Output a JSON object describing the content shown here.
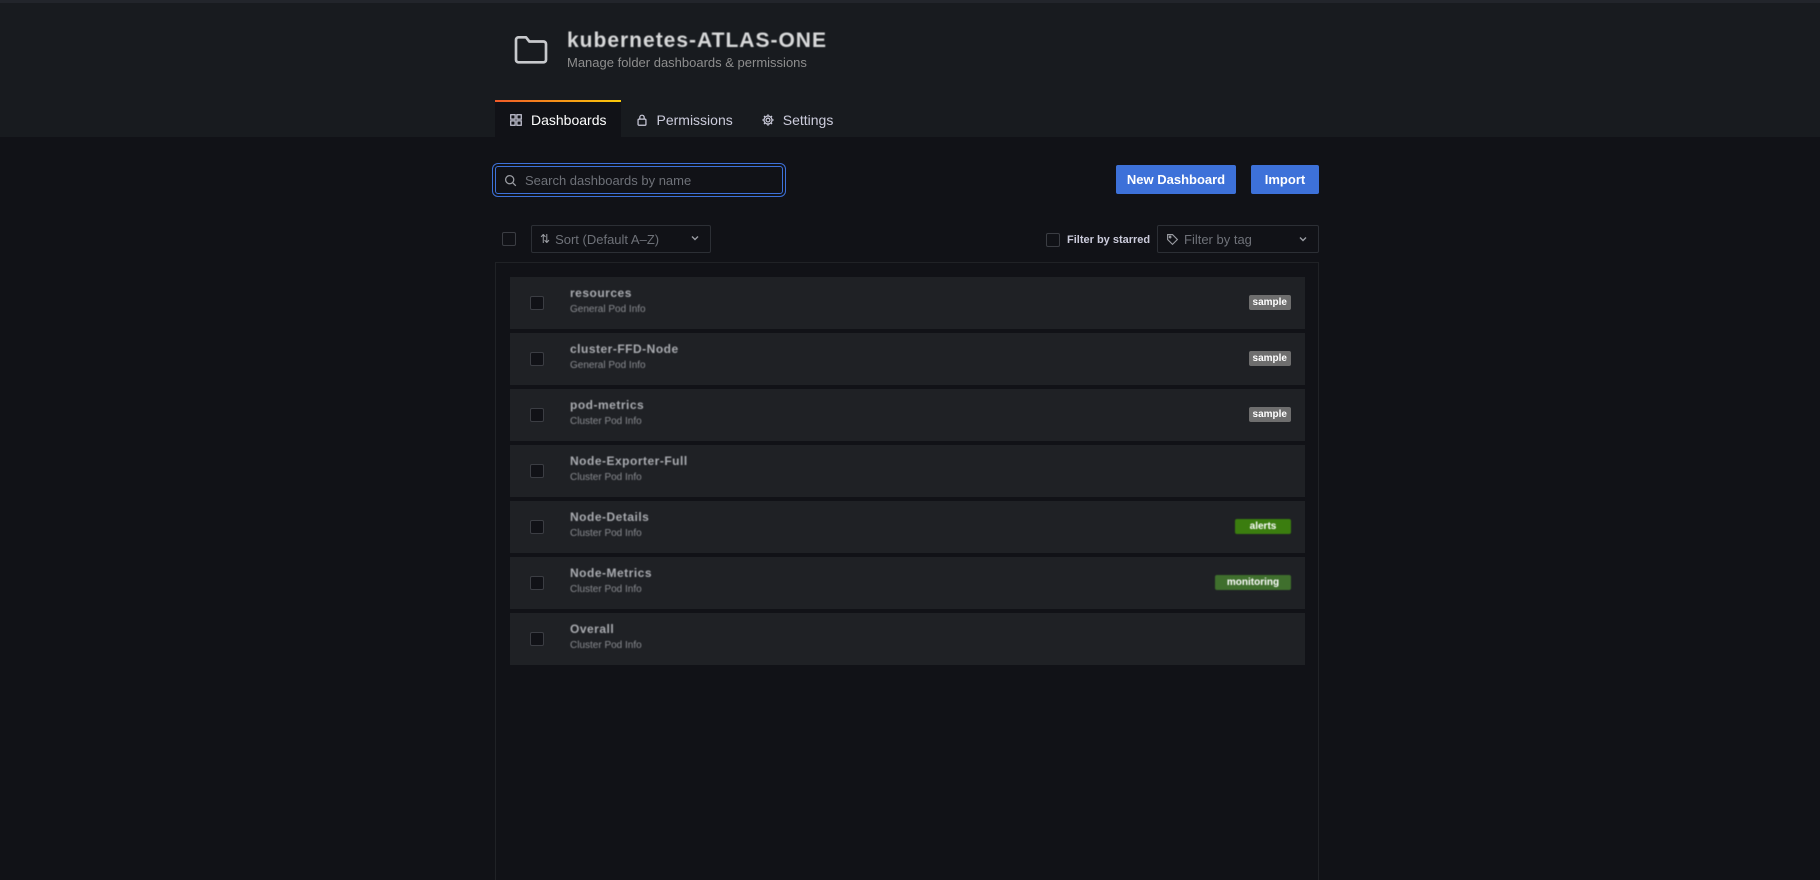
{
  "header": {
    "title": "kubernetes-ATLAS-ONE",
    "subtitle": "Manage folder dashboards & permissions"
  },
  "tabs": [
    {
      "label": "Dashboards",
      "active": true,
      "icon": "grid-icon"
    },
    {
      "label": "Permissions",
      "active": false,
      "icon": "lock-icon"
    },
    {
      "label": "Settings",
      "active": false,
      "icon": "gear-icon"
    }
  ],
  "search": {
    "placeholder": "Search dashboards by name",
    "value": ""
  },
  "actions": {
    "new_dashboard": "New Dashboard",
    "import": "Import"
  },
  "filters": {
    "sort_label": "Sort (Default A–Z)",
    "starred_label": "Filter by starred",
    "tag_placeholder": "Filter by tag"
  },
  "dashboards": [
    {
      "name": "resources",
      "folder": "General Pod Info",
      "tag": "sample",
      "tag_color": "#6e6e6e"
    },
    {
      "name": "cluster-FFD-Node",
      "folder": "General Pod Info",
      "tag": "sample",
      "tag_color": "#6e6e6e"
    },
    {
      "name": "pod-metrics",
      "folder": "Cluster Pod Info",
      "tag": "sample",
      "tag_color": "#6e6e6e"
    },
    {
      "name": "Node-Exporter-Full",
      "folder": "Cluster Pod Info",
      "tag": "",
      "tag_color": ""
    },
    {
      "name": "Node-Details",
      "folder": "Cluster Pod Info",
      "tag": "alerts",
      "tag_color": "#3b7d0f"
    },
    {
      "name": "Node-Metrics",
      "folder": "Cluster Pod Info",
      "tag": "monitoring",
      "tag_color": "#3f6f2d"
    },
    {
      "name": "Overall",
      "folder": "Cluster Pod Info",
      "tag": "",
      "tag_color": ""
    }
  ],
  "colors": {
    "accent": "#3d71d9",
    "background": "#111217",
    "panel": "#181b1f"
  }
}
